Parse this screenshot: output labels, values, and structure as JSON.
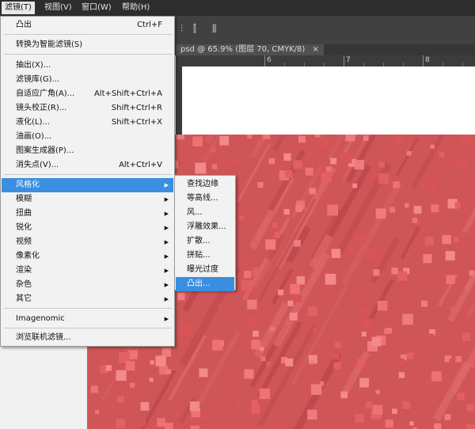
{
  "menubar": {
    "items": [
      {
        "label": "滤镜(T)"
      },
      {
        "label": "视图(V)"
      },
      {
        "label": "窗口(W)"
      },
      {
        "label": "帮助(H)"
      }
    ]
  },
  "document_tab": {
    "title": "psd @ 65.9% (图层 70, CMYK/8)",
    "close": "×"
  },
  "ruler": {
    "labels": [
      "6",
      "7",
      "8"
    ]
  },
  "filter_menu": {
    "last_filter": {
      "label": "凸出",
      "shortcut": "Ctrl+F"
    },
    "convert_smart": {
      "label": "转换为智能滤镜(S)"
    },
    "group1": [
      {
        "label": "抽出(X)...",
        "shortcut": ""
      },
      {
        "label": "滤镜库(G)...",
        "shortcut": ""
      },
      {
        "label": "自适应广角(A)...",
        "shortcut": "Alt+Shift+Ctrl+A"
      },
      {
        "label": "镜头校正(R)...",
        "shortcut": "Shift+Ctrl+R"
      },
      {
        "label": "液化(L)...",
        "shortcut": "Shift+Ctrl+X"
      },
      {
        "label": "油画(O)...",
        "shortcut": ""
      },
      {
        "label": "图案生成器(P)...",
        "shortcut": ""
      },
      {
        "label": "消失点(V)...",
        "shortcut": "Alt+Ctrl+V"
      }
    ],
    "group2": [
      {
        "label": "风格化"
      },
      {
        "label": "模糊"
      },
      {
        "label": "扭曲"
      },
      {
        "label": "锐化"
      },
      {
        "label": "视频"
      },
      {
        "label": "像素化"
      },
      {
        "label": "渲染"
      },
      {
        "label": "杂色"
      },
      {
        "label": "其它"
      }
    ],
    "imagenomic": {
      "label": "Imagenomic"
    },
    "browse_online": {
      "label": "浏览联机滤镜..."
    }
  },
  "stylize_submenu": {
    "items": [
      {
        "label": "查找边缘"
      },
      {
        "label": "等高线..."
      },
      {
        "label": "风..."
      },
      {
        "label": "浮雕效果..."
      },
      {
        "label": "扩散..."
      },
      {
        "label": "拼贴..."
      },
      {
        "label": "曝光过度"
      },
      {
        "label": "凸出..."
      }
    ]
  },
  "colors": {
    "selection": "#3b8fe0",
    "artwork": "#cf5557"
  },
  "icons": [
    "align-left-icon",
    "align-center-icon",
    "distribute-icon"
  ]
}
